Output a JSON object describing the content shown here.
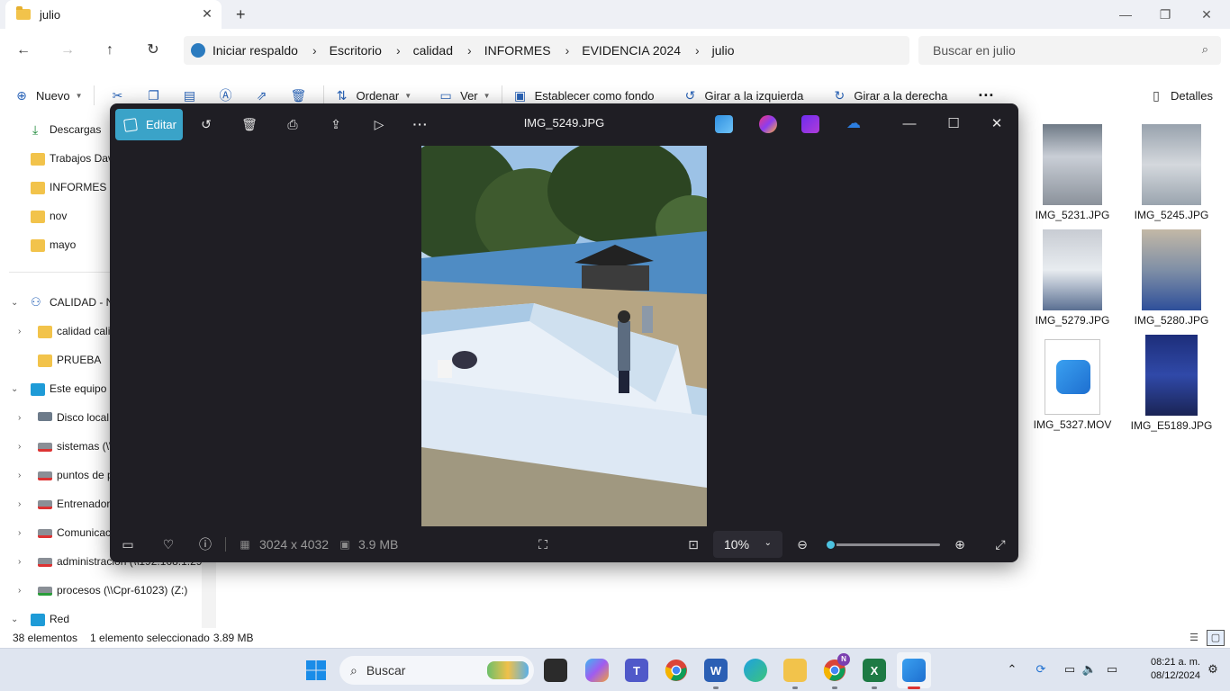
{
  "explorer": {
    "tab_title": "julio",
    "breadcrumb": [
      "Iniciar respaldo",
      "Escritorio",
      "calidad",
      "INFORMES",
      "EVIDENCIA 2024",
      "julio"
    ],
    "search_placeholder": "Buscar en julio",
    "toolbar": {
      "new_label": "Nuevo",
      "sort_label": "Ordenar",
      "view_label": "Ver",
      "set_background_label": "Establecer como fondo",
      "rotate_left_label": "Girar a la izquierda",
      "rotate_right_label": "Girar a la derecha",
      "more_label": "···",
      "details_label": "Detalles"
    },
    "nav_items": [
      {
        "label": "Descargas",
        "icon": "download-icon"
      },
      {
        "label": "Trabajos Dav",
        "icon": "folder-icon"
      },
      {
        "label": "INFORMES",
        "icon": "folder-icon"
      },
      {
        "label": "nov",
        "icon": "folder-icon"
      },
      {
        "label": "mayo",
        "icon": "folder-icon"
      },
      {
        "label": "CALIDAD - N",
        "icon": "group-icon"
      },
      {
        "label": "calidad cali",
        "icon": "shared-folder-icon"
      },
      {
        "label": "PRUEBA",
        "icon": "shared-folder-icon"
      },
      {
        "label": "Este equipo",
        "icon": "computer-icon"
      },
      {
        "label": "Disco local",
        "icon": "drive-icon"
      },
      {
        "label": "sistemas (\\\\",
        "icon": "network-drive-icon"
      },
      {
        "label": "puntos de p",
        "icon": "network-drive-icon"
      },
      {
        "label": "Entrenador",
        "icon": "network-drive-icon"
      },
      {
        "label": "Comunicaci",
        "icon": "network-drive-icon"
      },
      {
        "label": "administración (\\\\192.168.1.29",
        "icon": "network-drive-icon"
      },
      {
        "label": "procesos (\\\\Cpr-61023) (Z:)",
        "icon": "network-drive-icon"
      },
      {
        "label": "Red",
        "icon": "network-icon"
      }
    ],
    "files": [
      {
        "name": "IMG_5231.JPG"
      },
      {
        "name": "IMG_5245.JPG"
      },
      {
        "name": "IMG_5279.JPG"
      },
      {
        "name": "IMG_5280.JPG"
      },
      {
        "name": "IMG_5327.MOV"
      },
      {
        "name": "IMG_E5189.JPG"
      }
    ],
    "status": {
      "count": "38 elementos",
      "selection": "1 elemento seleccionado",
      "size": "3.89 MB"
    }
  },
  "viewer": {
    "edit_label": "Editar",
    "file_name": "IMG_5249.JPG",
    "dimensions": "3024 x 4032",
    "file_size": "3.9 MB",
    "zoom": "10%",
    "zoom_level": 0.0,
    "accent": "#3aa3c8"
  },
  "taskbar": {
    "search_label": "Buscar",
    "time": "08:21 a. m.",
    "date": "08/12/2024",
    "chrome_badge": "N"
  }
}
